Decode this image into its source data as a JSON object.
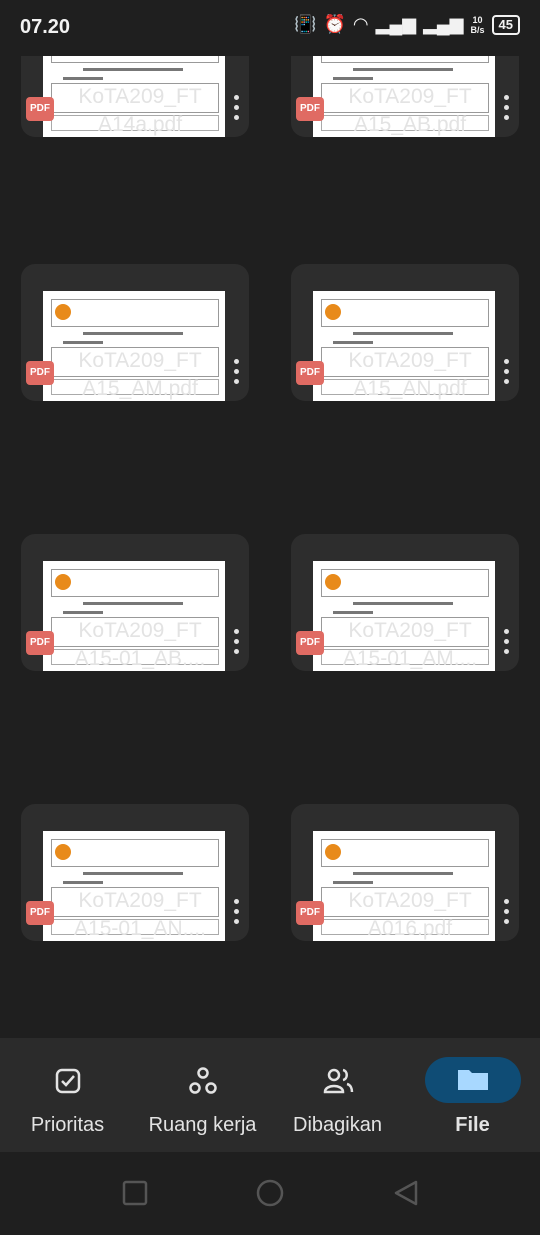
{
  "status": {
    "time": "07.20",
    "net_top": "10",
    "net_bottom": "B/s",
    "battery": "45"
  },
  "files": [
    {
      "name": "KoTA209_FT\nA14a.pdf",
      "line1": "KoTA209_FT",
      "line2": "A14a.pdf"
    },
    {
      "name": "KoTA209_FT\nA15_AB.pdf",
      "line1": "KoTA209_FT",
      "line2": "A15_AB.pdf"
    },
    {
      "name": "KoTA209_FT\nA15_AM.pdf",
      "line1": "KoTA209_FT",
      "line2": "A15_AM.pdf"
    },
    {
      "name": "KoTA209_FT\nA15_AN.pdf",
      "line1": "KoTA209_FT",
      "line2": "A15_AN.pdf"
    },
    {
      "name": "KoTA209_FT\nA15-01_AB....",
      "line1": "KoTA209_FT",
      "line2": "A15-01_AB...."
    },
    {
      "name": "KoTA209_FT\nA15-01_AM....",
      "line1": "KoTA209_FT",
      "line2": "A15-01_AM...."
    },
    {
      "name": "KoTA209_FT\nA15-01_AN....",
      "line1": "KoTA209_FT",
      "line2": "A15-01_AN...."
    },
    {
      "name": "KoTA209_FT\nA016.pdf",
      "line1": "KoTA209_FT",
      "line2": "A016.pdf"
    }
  ],
  "pdf_badge": "PDF",
  "nav": [
    {
      "label": "Prioritas",
      "icon": "checkbox-icon"
    },
    {
      "label": "Ruang kerja",
      "icon": "workspace-icon"
    },
    {
      "label": "Dibagikan",
      "icon": "people-icon"
    },
    {
      "label": "File",
      "icon": "folder-icon"
    }
  ],
  "colors": {
    "accent": "#0f4c75",
    "pdf": "#e06b63",
    "bg": "#1f1f1f"
  }
}
